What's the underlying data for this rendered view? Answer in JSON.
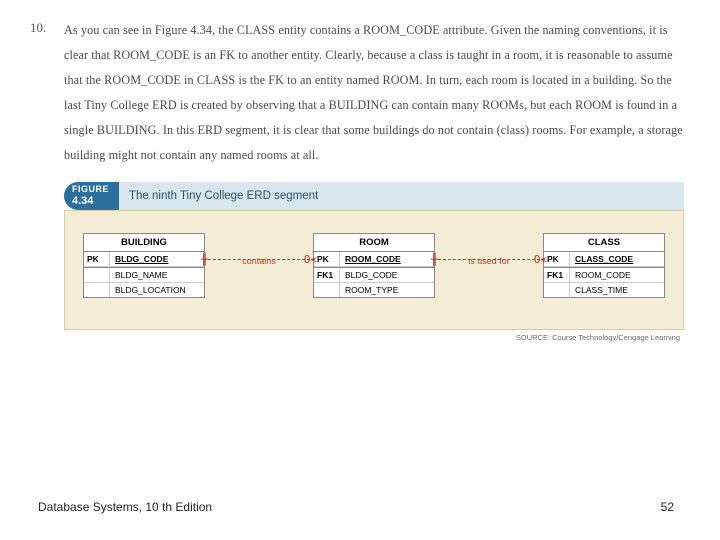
{
  "item_number": "10.",
  "paragraph": "As you can see in Figure 4.34, the CLASS entity contains a ROOM_CODE attribute. Given the naming conventions, it is clear that ROOM_CODE is an FK to another entity. Clearly, because a class is taught in a room, it is reasonable to assume that the ROOM_CODE in CLASS is the FK to an entity named ROOM. In turn, each room is located in a building. So the last Tiny College ERD is created by observing that a BUILDING can contain many ROOMs, but each ROOM is found in a single BUILDING. In this ERD segment, it is clear that some buildings do not contain (class) rooms. For example, a storage building might not contain any named rooms at all.",
  "figure": {
    "label": "FIGURE",
    "number": "4.34",
    "caption": "The ninth Tiny College ERD segment",
    "source": "SOURCE: Course Technology/Cengage Learning"
  },
  "erd": {
    "entities": [
      {
        "name": "BUILDING",
        "rows": [
          {
            "key": "PK",
            "attr": "BLDG_CODE",
            "pk": true
          },
          {
            "key": "",
            "attr": "BLDG_NAME",
            "section": true
          },
          {
            "key": "",
            "attr": "BLDG_LOCATION"
          }
        ]
      },
      {
        "name": "ROOM",
        "rows": [
          {
            "key": "PK",
            "attr": "ROOM_CODE",
            "pk": true
          },
          {
            "key": "FK1",
            "attr": "BLDG_CODE",
            "section": true
          },
          {
            "key": "",
            "attr": "ROOM_TYPE"
          }
        ]
      },
      {
        "name": "CLASS",
        "rows": [
          {
            "key": "PK",
            "attr": "CLASS_CODE",
            "pk": true
          },
          {
            "key": "FK1",
            "attr": "ROOM_CODE",
            "section": true
          },
          {
            "key": "",
            "attr": "CLASS_TIME"
          }
        ]
      }
    ],
    "relationships": [
      {
        "label": "contains"
      },
      {
        "label": "is used for"
      }
    ]
  },
  "footer": {
    "left": "Database Systems, 10 th Edition",
    "right": "52"
  }
}
